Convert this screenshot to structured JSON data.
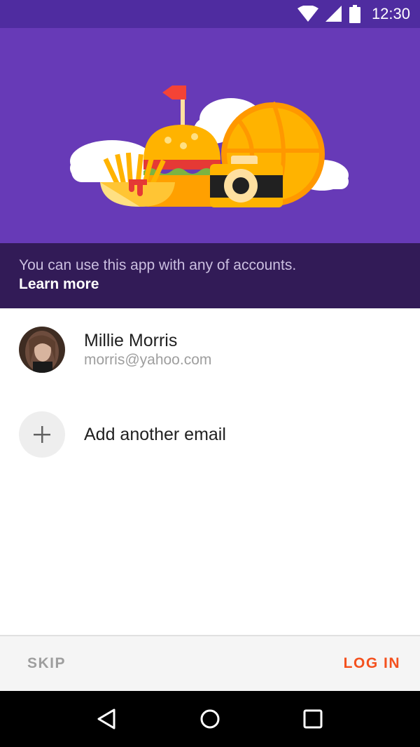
{
  "status_bar": {
    "time": "12:30",
    "icons": [
      "wifi-icon",
      "cell-signal-icon",
      "battery-icon"
    ]
  },
  "hero": {
    "illustration": "food-and-activities-illustration",
    "background_color": "#673ab7"
  },
  "info": {
    "text": "You can use this app with any of accounts.",
    "learn_more": "Learn more"
  },
  "accounts": [
    {
      "name": "Millie Morris",
      "email": "morris@yahoo.com"
    }
  ],
  "add_account": {
    "label": "Add another email",
    "icon": "plus-icon"
  },
  "actions": {
    "skip": "SKIP",
    "login": "LOG IN",
    "accent_color": "#f4511e"
  },
  "nav": {
    "icons": [
      "back-icon",
      "home-icon",
      "recents-icon"
    ]
  }
}
